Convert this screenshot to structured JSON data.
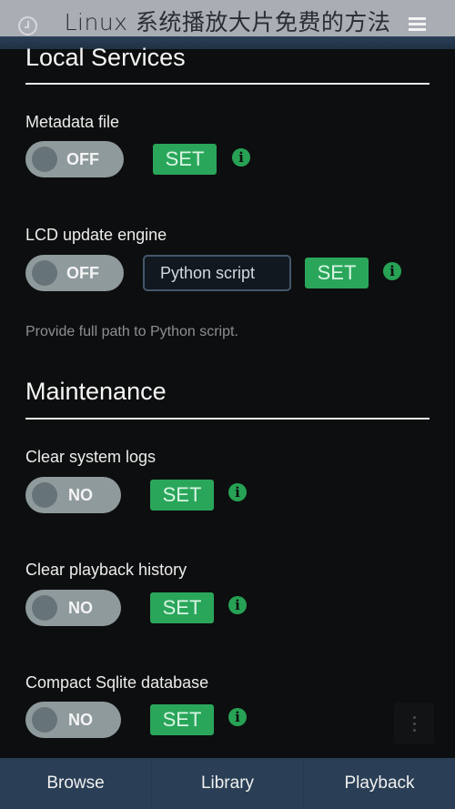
{
  "header": {
    "title": "Linux 系统播放大片免费的方法",
    "left_icon": "history-icon",
    "right_icon": "menu-icon"
  },
  "sections": [
    {
      "title": "Local Services",
      "settings": [
        {
          "label": "Metadata file",
          "toggle": "OFF",
          "set_label": "SET",
          "info_icon": "info-icon"
        },
        {
          "label": "LCD update engine",
          "toggle": "OFF",
          "input_placeholder": "Python script",
          "input_value": "",
          "set_label": "SET",
          "info_icon": "info-icon",
          "help": "Provide full path to Python script."
        }
      ]
    },
    {
      "title": "Maintenance",
      "settings": [
        {
          "label": "Clear system logs",
          "toggle": "NO",
          "set_label": "SET",
          "info_icon": "info-icon"
        },
        {
          "label": "Clear playback history",
          "toggle": "NO",
          "set_label": "SET",
          "info_icon": "info-icon"
        },
        {
          "label": "Compact Sqlite database",
          "toggle": "NO",
          "set_label": "SET",
          "info_icon": "info-icon"
        }
      ]
    }
  ],
  "fab": {
    "icon": "more-vertical-icon"
  },
  "bottom_nav": {
    "tabs": [
      {
        "label": "Browse"
      },
      {
        "label": "Library"
      },
      {
        "label": "Playback"
      }
    ]
  },
  "colors": {
    "accent_green": "#2aa65b",
    "header_bg": "#a9adb4",
    "nav_bg": "#2a3f55",
    "page_bg": "#0d0e0f"
  }
}
